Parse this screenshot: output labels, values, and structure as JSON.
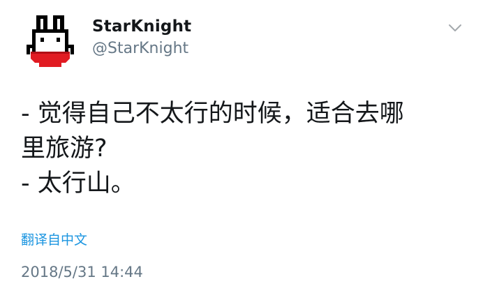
{
  "tweet": {
    "display_name": "StarKnight",
    "handle": "@StarKnight",
    "text_lines": [
      "- 觉得自己不太行的时候，适合去哪",
      "里旅游?",
      "- 太行山。"
    ],
    "translate_label": "翻译自中文",
    "timestamp": "2018/5/31 14:44"
  },
  "icons": {
    "avatar": "pixel-character-avatar",
    "menu": "chevron-down-icon"
  },
  "colors": {
    "name": "#14171a",
    "secondary": "#657786",
    "link": "#1b95e0",
    "avatar_accent": "#e11b22"
  }
}
